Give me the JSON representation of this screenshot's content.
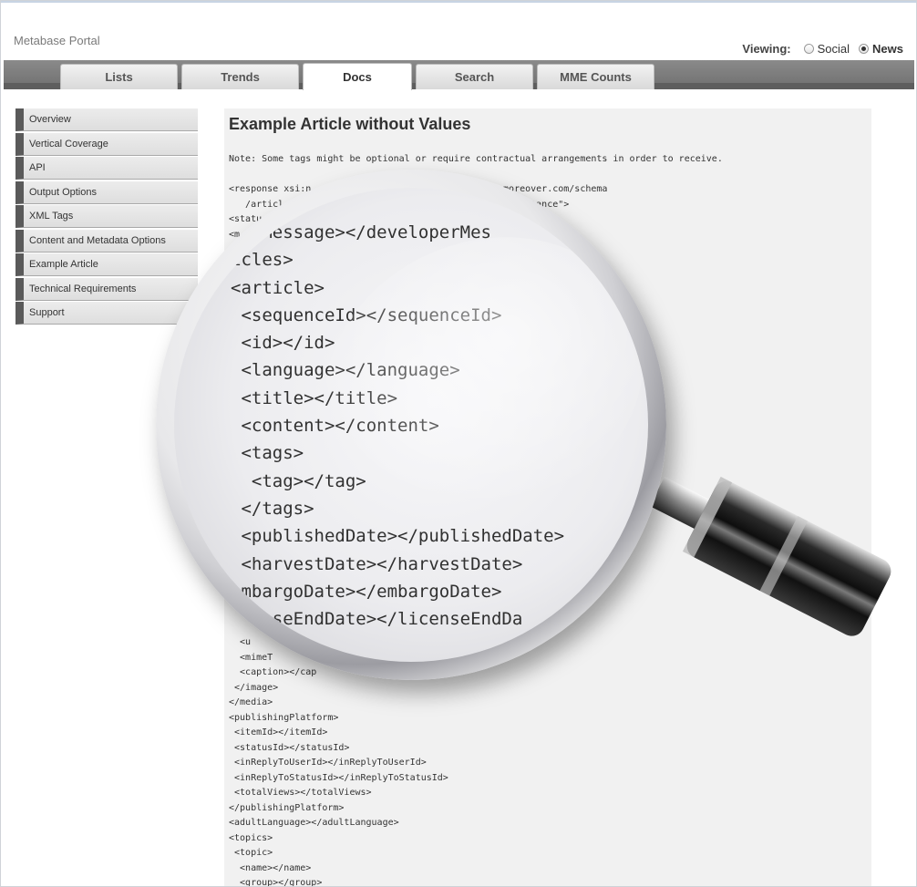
{
  "brand": "Metabase Portal",
  "viewing": {
    "label": "Viewing:",
    "options": [
      {
        "label": "Social",
        "selected": false
      },
      {
        "label": "News",
        "selected": true
      }
    ]
  },
  "tabs": [
    {
      "label": "Lists"
    },
    {
      "label": "Trends"
    },
    {
      "label": "Docs"
    },
    {
      "label": "Search"
    },
    {
      "label": "MME Counts"
    }
  ],
  "active_tab": "Docs",
  "sidebar": {
    "items": [
      {
        "label": "Overview"
      },
      {
        "label": "Vertical Coverage"
      },
      {
        "label": "API"
      },
      {
        "label": "Output Options"
      },
      {
        "label": "XML Tags"
      },
      {
        "label": "Content and Metadata Options"
      },
      {
        "label": "Example Article"
      },
      {
        "label": "Technical Requirements"
      },
      {
        "label": "Support"
      }
    ]
  },
  "main": {
    "title": "Example Article without Values",
    "note": "Note: Some tags might be optional or require contractual arrangements in order to receive.",
    "code_top": "<response xsi:n                             .hase.moreover.com/schema\n   /articl                                   Schema-instance\">\n<statu\n<m",
    "code_bottom": "  <u\n  <mimeT\n  <caption></cap\n </image>\n</media>\n<publishingPlatform>\n <itemId></itemId>\n <statusId></statusId>\n <inReplyToUserId></inReplyToUserId>\n <inReplyToStatusId></inReplyToStatusId>\n <totalViews></totalViews>\n</publishingPlatform>\n<adultLanguage></adultLanguage>\n<topics>\n <topic>\n  <name></name>\n  <group></group>"
  },
  "magnifier": {
    "lines": [
      "  rMessage></developerMes",
      "icles>",
      "<article>",
      " <sequenceId></sequenceId>",
      " <id></id>",
      " <language></language>",
      " <title></title>",
      " <content></content>",
      " <tags>",
      "  <tag></tag>",
      " </tags>",
      " <publishedDate></publishedDate>",
      " <harvestDate></harvestDate>",
      "embargoDate></embargoDate>",
      "icenseEndDate></licenseEndDa"
    ]
  }
}
